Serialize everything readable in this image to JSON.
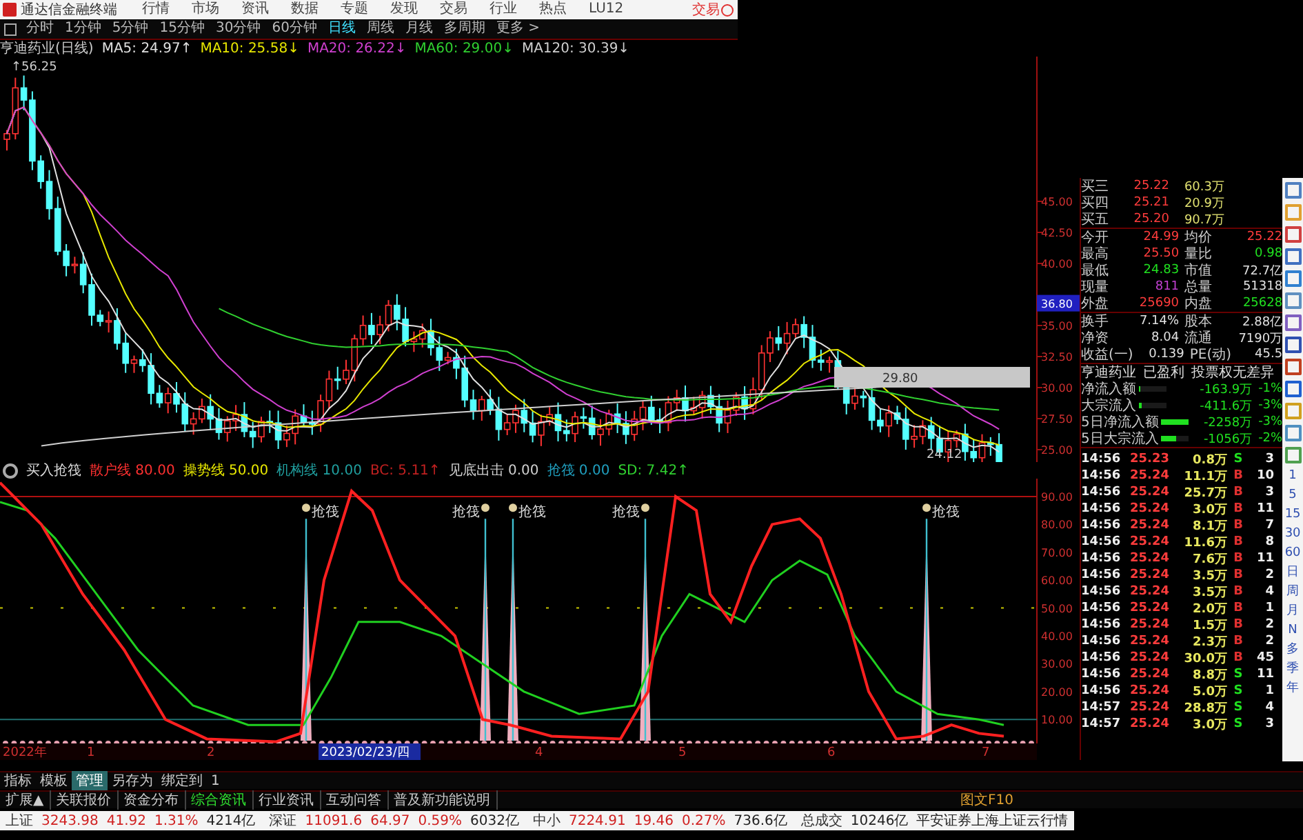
{
  "menubar": {
    "app_title": "通达信金融终端",
    "items": [
      "行情",
      "市场",
      "资讯",
      "数据",
      "专题",
      "发现",
      "交易",
      "行业",
      "热点",
      "LU12"
    ],
    "trade_button": "交易"
  },
  "period_tabs": [
    {
      "label": "分时",
      "selected": false
    },
    {
      "label": "1分钟",
      "selected": false
    },
    {
      "label": "5分钟",
      "selected": false
    },
    {
      "label": "15分钟",
      "selected": false
    },
    {
      "label": "30分钟",
      "selected": false
    },
    {
      "label": "60分钟",
      "selected": false
    },
    {
      "label": "日线",
      "selected": true
    },
    {
      "label": "周线",
      "selected": false
    },
    {
      "label": "月线",
      "selected": false
    },
    {
      "label": "多周期",
      "selected": false
    },
    {
      "label": "更多 >",
      "selected": false
    }
  ],
  "main_chart": {
    "title": "亨迪药业(日线)",
    "ma_readings": [
      {
        "label": "MA5: 24.97↑",
        "color": "#e0e0e0"
      },
      {
        "label": "MA10: 25.58↓",
        "color": "#e8e800"
      },
      {
        "label": "MA20: 26.22↓",
        "color": "#d040d0"
      },
      {
        "label": "MA60: 29.00↓",
        "color": "#30d030"
      },
      {
        "label": "MA120: 30.39↓",
        "color": "#d0d0d0"
      }
    ],
    "high_label": "↑56.25",
    "low_label": "24.12",
    "box_label": "29.80",
    "cursor_price": "36.80",
    "price_axis": [
      "45.00",
      "42.50",
      "40.00",
      "35.00",
      "32.50",
      "30.00",
      "27.50",
      "25.00"
    ]
  },
  "indicator": {
    "name": "买入抢筏",
    "readings": [
      {
        "label": "散户线",
        "value": "80.00",
        "color": "#ff3030"
      },
      {
        "label": "操势线",
        "value": "50.00",
        "color": "#e8e800"
      },
      {
        "label": "机构线",
        "value": "10.00",
        "color": "#20a0a0"
      },
      {
        "label": "BC:",
        "value": "5.11↑",
        "color": "#c02020"
      },
      {
        "label": "见底出击",
        "value": "0.00",
        "color": "#d0d0d0"
      },
      {
        "label": "抢筏",
        "value": "0.00",
        "color": "#20a0c0"
      },
      {
        "label": "SD:",
        "value": "7.42↑",
        "color": "#30d030"
      }
    ],
    "axis": [
      "90.00",
      "80.00",
      "70.00",
      "60.00",
      "50.00",
      "40.00",
      "30.00",
      "20.00",
      "10.00"
    ],
    "signals": [
      {
        "label": "抢筏"
      },
      {
        "label": "抢筏"
      },
      {
        "label": "抢筏"
      },
      {
        "label": "抢筏"
      },
      {
        "label": "抢筏"
      }
    ]
  },
  "date_axis": [
    {
      "label": "2022年",
      "highlighted": false
    },
    {
      "label": "1",
      "highlighted": false
    },
    {
      "label": "2",
      "highlighted": false
    },
    {
      "label": "2023/02/23/四",
      "highlighted": true
    },
    {
      "label": "4",
      "highlighted": false
    },
    {
      "label": "5",
      "highlighted": false
    },
    {
      "label": "6",
      "highlighted": false
    },
    {
      "label": "7",
      "highlighted": false
    }
  ],
  "quote_panel": {
    "order_book": [
      {
        "label": "买三",
        "price": "25.22",
        "volume": "60.3万"
      },
      {
        "label": "买四",
        "price": "25.21",
        "volume": "20.9万"
      },
      {
        "label": "买五",
        "price": "25.20",
        "volume": "90.7万"
      }
    ],
    "stats": [
      {
        "left": {
          "label": "今开",
          "value": "24.99",
          "color": "#ff3c3c"
        },
        "right": {
          "label": "均价",
          "value": "25.22",
          "color": "#ff3c3c"
        }
      },
      {
        "left": {
          "label": "最高",
          "value": "25.50",
          "color": "#ff3c3c"
        },
        "right": {
          "label": "量比",
          "value": "0.98",
          "color": "#20e020"
        }
      },
      {
        "left": {
          "label": "最低",
          "value": "24.83",
          "color": "#20e020"
        },
        "right": {
          "label": "市值",
          "value": "72.7亿",
          "color": "#e0e0e0"
        }
      },
      {
        "left": {
          "label": "现量",
          "value": "811",
          "color": "#c040d0"
        },
        "right": {
          "label": "总量",
          "value": "51318",
          "color": "#e0e0e0"
        }
      },
      {
        "left": {
          "label": "外盘",
          "value": "25690",
          "color": "#ff3c3c"
        },
        "right": {
          "label": "内盘",
          "value": "25628",
          "color": "#20e020"
        }
      },
      {
        "left": {
          "label": "换手",
          "value": "7.14%",
          "color": "#e0e0e0"
        },
        "right": {
          "label": "股本",
          "value": "2.88亿",
          "color": "#e0e0e0"
        }
      },
      {
        "left": {
          "label": "净资",
          "value": "8.04",
          "color": "#e0e0e0"
        },
        "right": {
          "label": "流通",
          "value": "7190万",
          "color": "#e0e0e0"
        }
      },
      {
        "left": {
          "label": "收益(一)",
          "value": "0.139",
          "color": "#e0e0e0"
        },
        "right": {
          "label": "PE(动)",
          "value": "45.5",
          "color": "#e0e0e0"
        }
      }
    ],
    "profile_tags": [
      "亨迪药业",
      "已盈利",
      "投票权无差异"
    ],
    "fund_flow": [
      {
        "label": "净流入额",
        "level": 0.06,
        "amount": "-163.9万",
        "pct": "-1%"
      },
      {
        "label": "大宗流入",
        "level": 0.08,
        "amount": "-411.6万",
        "pct": "-3%"
      },
      {
        "label": "5日净流入额",
        "level": 1,
        "amount": "-2258万",
        "pct": "-3%"
      },
      {
        "label": "5日大宗流入",
        "level": 0.55,
        "amount": "-1056万",
        "pct": "-2%"
      }
    ]
  },
  "trades": [
    {
      "time": "14:56",
      "price": "25.23",
      "volume": "0.8万",
      "side": "S",
      "kind": "sell",
      "count": "3"
    },
    {
      "time": "14:56",
      "price": "25.24",
      "volume": "11.1万",
      "side": "B",
      "kind": "buy",
      "count": "10"
    },
    {
      "time": "14:56",
      "price": "25.24",
      "volume": "25.7万",
      "side": "B",
      "kind": "buy",
      "count": "3"
    },
    {
      "time": "14:56",
      "price": "25.24",
      "volume": "3.0万",
      "side": "B",
      "kind": "buy",
      "count": "11"
    },
    {
      "time": "14:56",
      "price": "25.24",
      "volume": "8.1万",
      "side": "B",
      "kind": "buy",
      "count": "7"
    },
    {
      "time": "14:56",
      "price": "25.24",
      "volume": "11.6万",
      "side": "B",
      "kind": "buy",
      "count": "8"
    },
    {
      "time": "14:56",
      "price": "25.24",
      "volume": "7.6万",
      "side": "B",
      "kind": "buy",
      "count": "11"
    },
    {
      "time": "14:56",
      "price": "25.24",
      "volume": "3.5万",
      "side": "B",
      "kind": "buy",
      "count": "2"
    },
    {
      "time": "14:56",
      "price": "25.24",
      "volume": "3.5万",
      "side": "B",
      "kind": "buy",
      "count": "4"
    },
    {
      "time": "14:56",
      "price": "25.24",
      "volume": "2.0万",
      "side": "B",
      "kind": "buy",
      "count": "1"
    },
    {
      "time": "14:56",
      "price": "25.24",
      "volume": "1.5万",
      "side": "B",
      "kind": "buy",
      "count": "2"
    },
    {
      "time": "14:56",
      "price": "25.24",
      "volume": "2.3万",
      "side": "B",
      "kind": "buy",
      "count": "2"
    },
    {
      "time": "14:56",
      "price": "25.24",
      "volume": "30.0万",
      "side": "B",
      "kind": "buy",
      "count": "45"
    },
    {
      "time": "14:56",
      "price": "25.24",
      "volume": "8.8万",
      "side": "S",
      "kind": "sell",
      "count": "11"
    },
    {
      "time": "14:56",
      "price": "25.24",
      "volume": "5.0万",
      "side": "S",
      "kind": "sell",
      "count": "1"
    },
    {
      "time": "14:57",
      "price": "25.24",
      "volume": "28.8万",
      "side": "S",
      "kind": "sell",
      "count": "4"
    },
    {
      "time": "14:57",
      "price": "25.24",
      "volume": "3.0万",
      "side": "S",
      "kind": "sell",
      "count": "3"
    }
  ],
  "side_periods": [
    "1",
    "5",
    "15",
    "30",
    "60",
    "日",
    "周",
    "月",
    "N",
    "多",
    "季",
    "年"
  ],
  "formula_tabs": [
    {
      "label": "指标",
      "selected": false
    },
    {
      "label": "模板",
      "selected": false
    },
    {
      "label": "管理",
      "selected": true
    },
    {
      "label": "另存为",
      "selected": false
    },
    {
      "label": "绑定到",
      "selected": false
    },
    {
      "label": "1",
      "selected": false
    }
  ],
  "info_tabs": [
    {
      "label": "扩展▲",
      "selected": false
    },
    {
      "label": "关联报价",
      "selected": false
    },
    {
      "label": "资金分布",
      "selected": false
    },
    {
      "label": "综合资讯",
      "selected": true
    },
    {
      "label": "行业资讯",
      "selected": false
    },
    {
      "label": "互动问答",
      "selected": false
    },
    {
      "label": "普及新功能说明",
      "selected": false
    }
  ],
  "f10_button": "图文F10",
  "status_bar": {
    "indices": [
      {
        "name": "上证",
        "value": "3243.98",
        "change": "41.92",
        "pct": "1.31%",
        "turnover": "4214亿"
      },
      {
        "name": "深证",
        "value": "11091.6",
        "change": "64.97",
        "pct": "0.59%",
        "turnover": "6032亿"
      },
      {
        "name": "中小",
        "value": "7224.91",
        "change": "19.46",
        "pct": "0.27%",
        "turnover": "736.6亿"
      }
    ],
    "total_label": "总成交",
    "total_value": "10246亿",
    "broker": "平安证券上海上证云行情"
  }
}
